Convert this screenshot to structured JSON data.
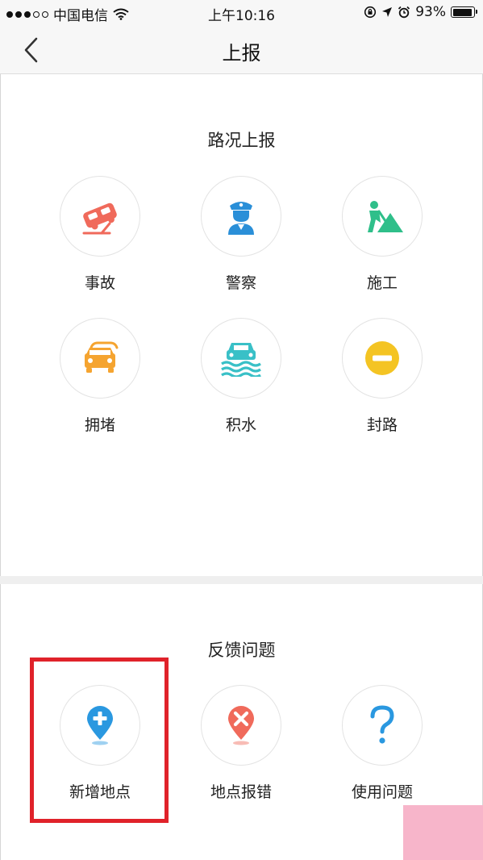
{
  "status_bar": {
    "carrier": "中国电信",
    "time": "上午10:16",
    "battery": "93%",
    "battery_level": 0.93
  },
  "nav": {
    "title": "上报",
    "back_icon": "chevron-left-icon"
  },
  "road_report": {
    "title": "路况上报",
    "items": [
      {
        "label": "事故",
        "icon": "accident-car-icon",
        "color": "#f06a5b"
      },
      {
        "label": "警察",
        "icon": "police-icon",
        "color": "#2a8fd8"
      },
      {
        "label": "施工",
        "icon": "construction-icon",
        "color": "#2fbf8a"
      },
      {
        "label": "拥堵",
        "icon": "traffic-jam-icon",
        "color": "#f5a430"
      },
      {
        "label": "积水",
        "icon": "flooding-icon",
        "color": "#39c0c7"
      },
      {
        "label": "封路",
        "icon": "road-closed-icon",
        "color": "#f4c423"
      }
    ]
  },
  "feedback": {
    "title": "反馈问题",
    "items": [
      {
        "label": "新增地点",
        "icon": "add-location-icon",
        "color": "#2a98e0"
      },
      {
        "label": "地点报错",
        "icon": "location-error-icon",
        "color": "#f06a5b"
      },
      {
        "label": "使用问题",
        "icon": "question-icon",
        "color": "#2a98e0"
      }
    ]
  }
}
